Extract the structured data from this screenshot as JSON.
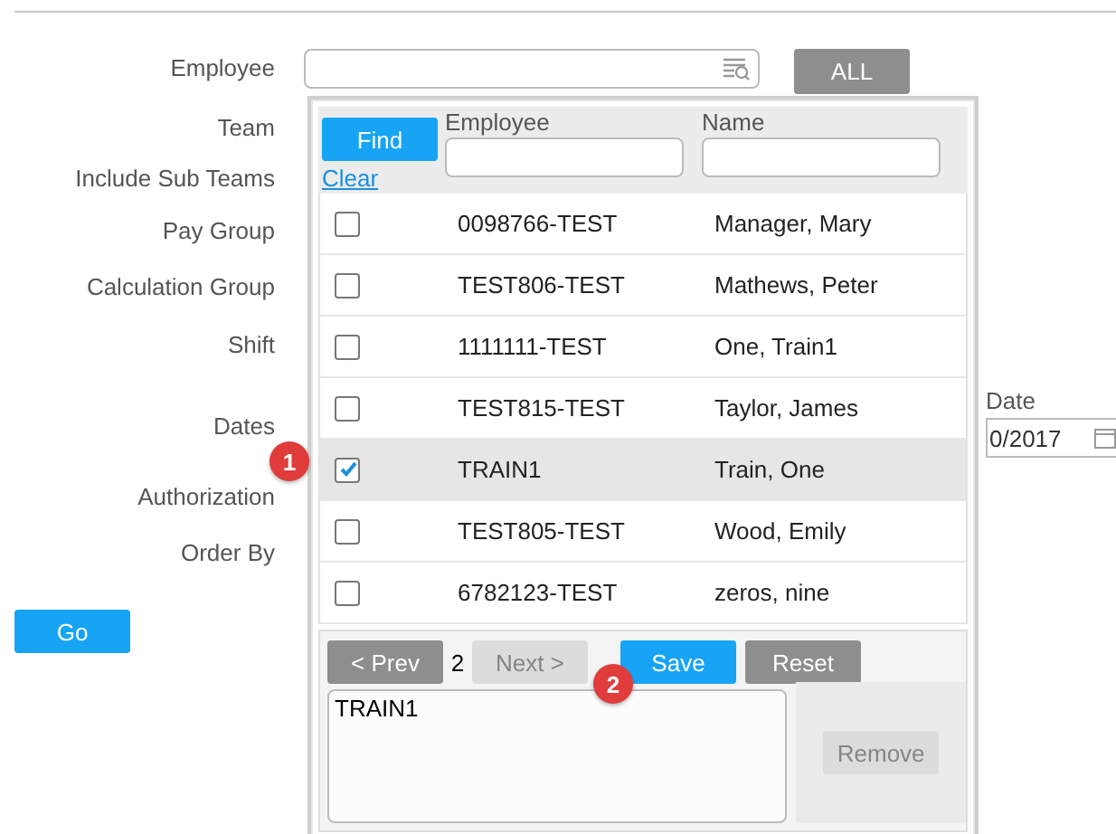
{
  "form": {
    "fields": [
      {
        "label": "Employee"
      },
      {
        "label": "Team"
      },
      {
        "label": "Include Sub Teams"
      },
      {
        "label": "Pay Group"
      },
      {
        "label": "Calculation Group"
      },
      {
        "label": "Shift"
      },
      {
        "label": "Dates",
        "end_date": {
          "label": "Date",
          "value": "0/2017"
        }
      },
      {
        "label": "Authorization"
      },
      {
        "label": "Order By"
      }
    ],
    "all_button": {
      "label": "ALL",
      "kind": "secondary",
      "disabled": false
    },
    "go_button": {
      "label": "Go",
      "kind": "primary",
      "disabled": false
    }
  },
  "popup": {
    "find_button": {
      "label": "Find",
      "kind": "primary",
      "disabled": false
    },
    "clear_link": "Clear",
    "columns": [
      "Employee",
      "Name"
    ],
    "rows": [
      {
        "employee": "0098766-TEST",
        "name": "Manager, Mary",
        "checked": false,
        "selected": false
      },
      {
        "employee": "TEST806-TEST",
        "name": "Mathews, Peter",
        "checked": false,
        "selected": false
      },
      {
        "employee": "1111111-TEST",
        "name": "One, Train1",
        "checked": false,
        "selected": false
      },
      {
        "employee": "TEST815-TEST",
        "name": "Taylor, James",
        "checked": false,
        "selected": false
      },
      {
        "employee": "TRAIN1",
        "name": "Train, One",
        "checked": true,
        "selected": true
      },
      {
        "employee": "TEST805-TEST",
        "name": "Wood, Emily",
        "checked": false,
        "selected": false
      },
      {
        "employee": "6782123-TEST",
        "name": "zeros, nine",
        "checked": false,
        "selected": false
      }
    ],
    "pager": {
      "prev": {
        "label": "< Prev",
        "kind": "secondary",
        "disabled": false
      },
      "page": "2",
      "next": {
        "label": "Next >",
        "kind": "secondary",
        "disabled": true
      }
    },
    "actions": [
      {
        "label": "Save",
        "kind": "primary",
        "disabled": false
      },
      {
        "label": "Reset",
        "kind": "secondary",
        "disabled": false
      }
    ],
    "selected_items": [
      "TRAIN1"
    ],
    "remove_button": {
      "label": "Remove",
      "kind": "secondary",
      "disabled": true
    }
  },
  "badges": [
    "1",
    "2"
  ]
}
